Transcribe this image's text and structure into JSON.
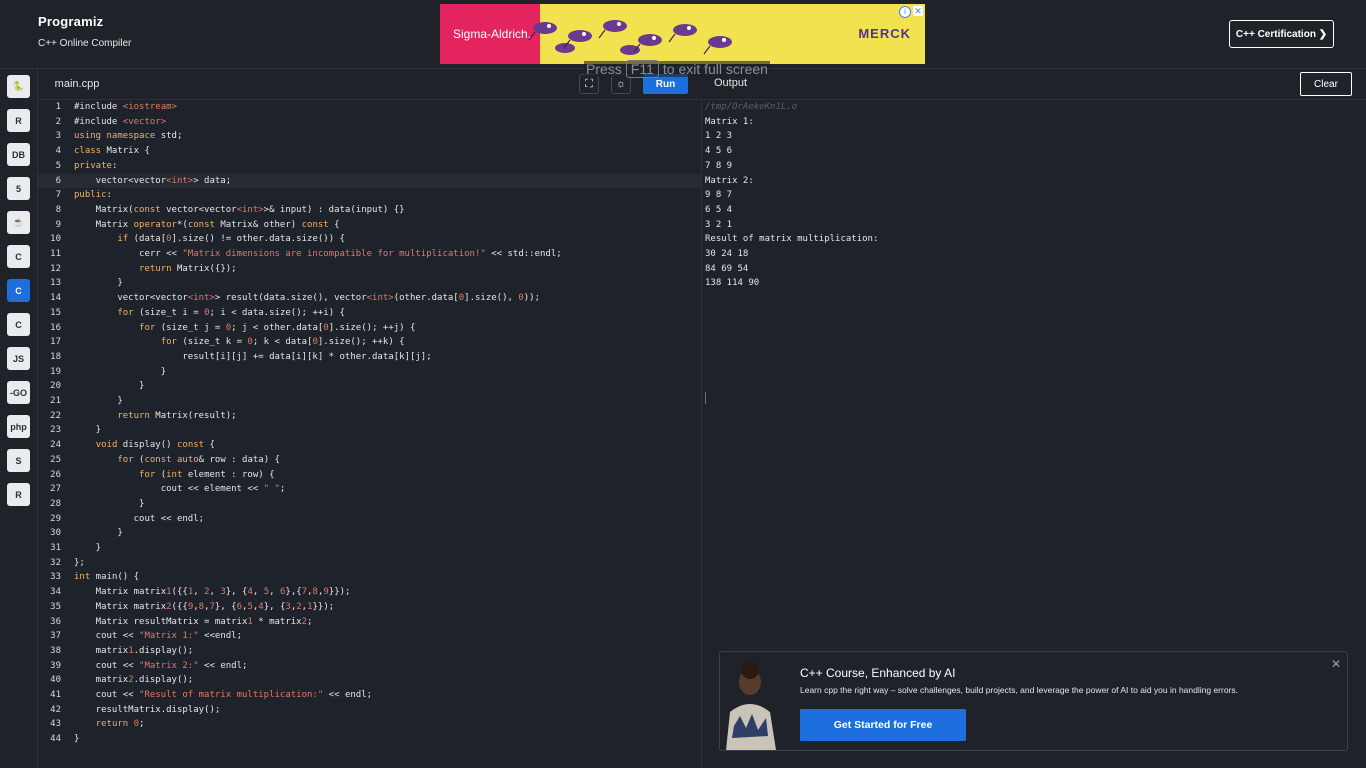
{
  "header": {
    "brand_name": "Programiz",
    "brand_subtitle": "C++ Online Compiler",
    "certification_button": "C++ Certification ❯"
  },
  "ad": {
    "left_brand": "Sigma-Aldrich.",
    "right_brand": "MERCK",
    "info_glyph": "i",
    "close_glyph": "✕"
  },
  "fullscreen_message": {
    "press": "Press",
    "key": "F11",
    "rest": "to exit full screen"
  },
  "sidebar": {
    "languages": [
      {
        "icon": "python-icon",
        "glyph": "🐍"
      },
      {
        "icon": "r-icon",
        "glyph": "R"
      },
      {
        "icon": "sql-icon",
        "glyph": "DB"
      },
      {
        "icon": "html-icon",
        "glyph": "5"
      },
      {
        "icon": "java-icon",
        "glyph": "☕"
      },
      {
        "icon": "c-icon",
        "glyph": "C"
      },
      {
        "icon": "cpp-icon",
        "glyph": "C"
      },
      {
        "icon": "csharp-icon",
        "glyph": "C"
      },
      {
        "icon": "js-icon",
        "glyph": "JS"
      },
      {
        "icon": "go-icon",
        "glyph": "-GO"
      },
      {
        "icon": "php-icon",
        "glyph": "php"
      },
      {
        "icon": "swift-icon",
        "glyph": "S"
      },
      {
        "icon": "rust-icon",
        "glyph": "R"
      }
    ],
    "active_index": 6
  },
  "editor": {
    "file_tab": "main.cpp",
    "run_button": "Run",
    "fullscreen_glyph": "⛶",
    "theme_glyph": "☼"
  },
  "code_lines": [
    "#include <iostream>",
    "#include <vector>",
    "using namespace std;",
    "class Matrix {",
    "private:",
    "    vector<vector<int>> data;",
    "public:",
    "    Matrix(const vector<vector<int>>& input) : data(input) {}",
    "    Matrix operator*(const Matrix& other) const {",
    "        if (data[0].size() != other.data.size()) {",
    "            cerr << \"Matrix dimensions are incompatible for multiplication!\" << std::endl;",
    "            return Matrix({});",
    "        }",
    "        vector<vector<int>> result(data.size(), vector<int>(other.data[0].size(), 0));",
    "        for (size_t i = 0; i < data.size(); ++i) {",
    "            for (size_t j = 0; j < other.data[0].size(); ++j) {",
    "                for (size_t k = 0; k < data[0].size(); ++k) {",
    "                    result[i][j] += data[i][k] * other.data[k][j];",
    "                }",
    "            }",
    "        }",
    "        return Matrix(result);",
    "    }",
    "    void display() const {",
    "        for (const auto& row : data) {",
    "            for (int element : row) {",
    "                cout << element << \" \";",
    "            }",
    "           cout << endl;",
    "        }",
    "    }",
    "};",
    "int main() {",
    "    Matrix matrix1({{1, 2, 3}, {4, 5, 6},{7,8,9}});",
    "    Matrix matrix2({{9,8,7}, {6,5,4}, {3,2,1}});",
    "    Matrix resultMatrix = matrix1 * matrix2;",
    "    cout << \"Matrix 1:\" <<endl;",
    "    matrix1.display();",
    "    cout << \"Matrix 2:\" << endl;",
    "    matrix2.display();",
    "    cout << \"Result of matrix multiplication:\" << endl;",
    "    resultMatrix.display();",
    "    return 0;",
    "}"
  ],
  "highlighted_line": 6,
  "output": {
    "title": "Output",
    "clear_button": "Clear",
    "path": "/tmp/OrAekeKn1L.o",
    "lines": [
      "Matrix 1:",
      "1 2 3",
      "4 5 6",
      "7 8 9",
      "Matrix 2:",
      "9 8 7",
      "6 5 4",
      "3 2 1",
      "Result of matrix multiplication:",
      "30 24 18",
      "84 69 54",
      "138 114 90"
    ]
  },
  "promo": {
    "title": "C++ Course, Enhanced by AI",
    "description": "Learn cpp the right way – solve challenges, build projects, and leverage the power of AI to aid you in handling errors.",
    "button": "Get Started for Free",
    "close_glyph": "✕"
  },
  "colors": {
    "background": "#1e222b",
    "accent": "#1d6fdd",
    "keyword": "#f0b16a",
    "string": "#e07a64"
  }
}
